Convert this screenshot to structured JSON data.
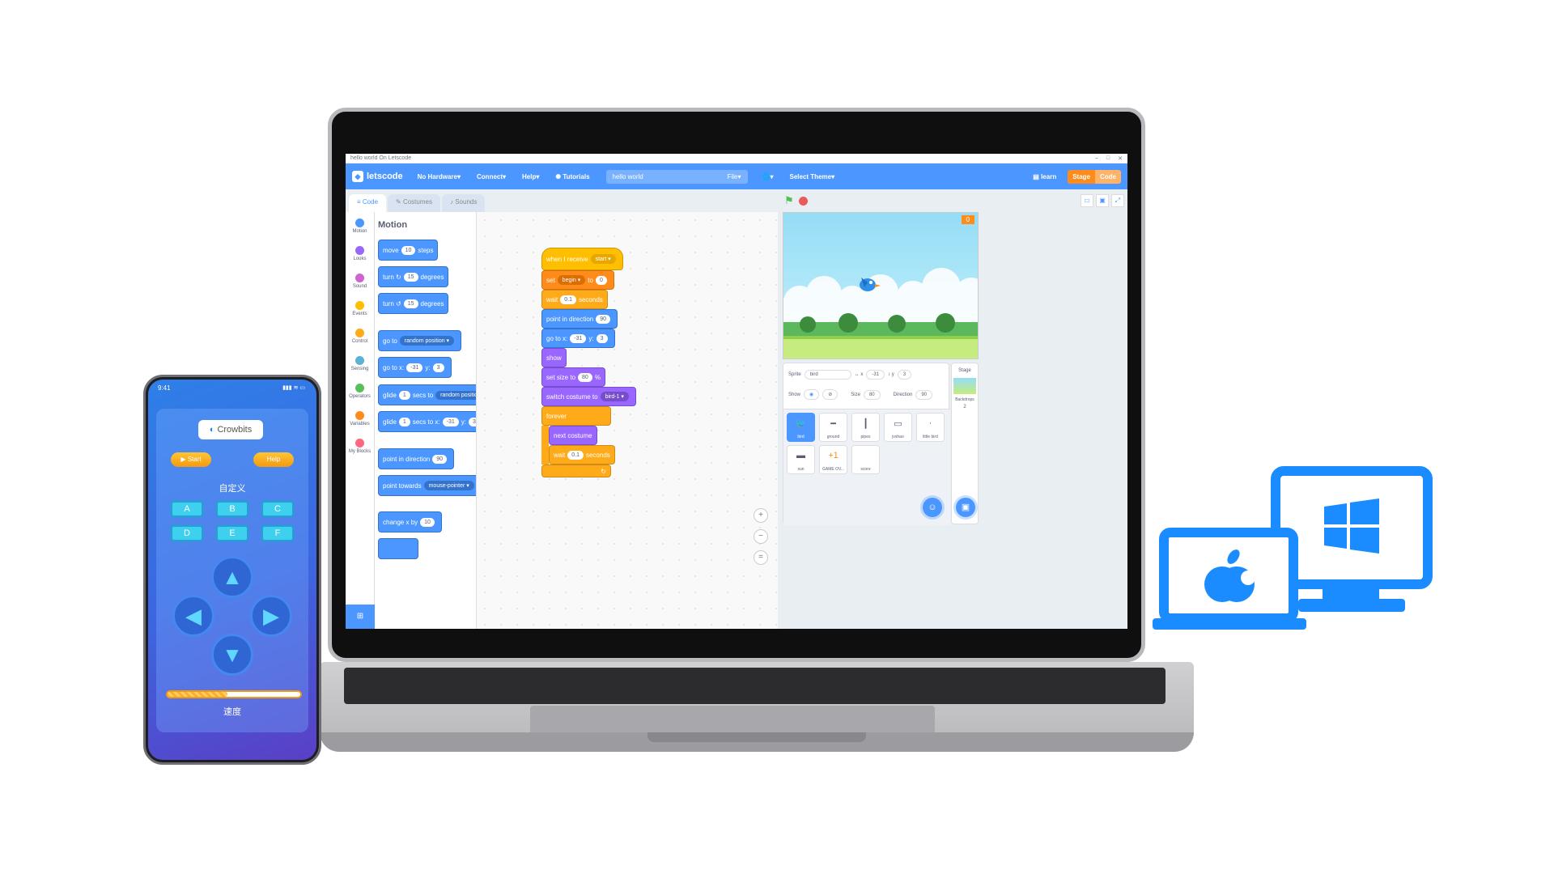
{
  "window": {
    "title": "hello world On Letscode",
    "controls": [
      "–",
      "□",
      "✕"
    ]
  },
  "menubar": {
    "logo": "letscode",
    "hardware": "No Hardware",
    "connect": "Connect",
    "help": "Help",
    "tutorials": "Tutorials",
    "project_name": "hello world",
    "file": "File",
    "theme": "Select Theme",
    "learn": "learn",
    "toggle_stage": "Stage",
    "toggle_code": "Code"
  },
  "tabs": {
    "code": "Code",
    "costumes": "Costumes",
    "sounds": "Sounds"
  },
  "categories": [
    {
      "label": "Motion",
      "color": "#4c97ff"
    },
    {
      "label": "Looks",
      "color": "#9966ff"
    },
    {
      "label": "Sound",
      "color": "#cf63cf"
    },
    {
      "label": "Events",
      "color": "#ffbf00"
    },
    {
      "label": "Control",
      "color": "#ffab19"
    },
    {
      "label": "Sensing",
      "color": "#5cb1d6"
    },
    {
      "label": "Operators",
      "color": "#59c059"
    },
    {
      "label": "Variables",
      "color": "#ff8c1a"
    },
    {
      "label": "My Blocks",
      "color": "#ff6680"
    }
  ],
  "palette": {
    "title": "Motion",
    "blocks": {
      "move": {
        "a": "move",
        "v": "10",
        "b": "steps"
      },
      "turn_r": {
        "a": "turn",
        "v": "15",
        "b": "degrees"
      },
      "turn_l": {
        "a": "turn",
        "v": "15",
        "b": "degrees"
      },
      "goto": {
        "a": "go to",
        "dd": "random position"
      },
      "gotoxy": {
        "a": "go to x:",
        "x": "-31",
        "b": "y:",
        "y": "3"
      },
      "glide1": {
        "a": "glide",
        "v": "1",
        "b": "secs to",
        "dd": "random position"
      },
      "glide2": {
        "a": "glide",
        "v": "1",
        "b": "secs to x:",
        "x": "-31",
        "c": "y:",
        "y": "3"
      },
      "point_dir": {
        "a": "point in direction",
        "v": "90"
      },
      "point_towards": {
        "a": "point towards",
        "dd": "mouse-pointer"
      },
      "change_x": {
        "a": "change x by",
        "v": "10"
      }
    }
  },
  "script": {
    "hat": {
      "a": "when I receive",
      "dd": "start"
    },
    "set": {
      "a": "set",
      "dd": "begin",
      "b": "to",
      "v": "0"
    },
    "wait1": {
      "a": "wait",
      "v": "0.1",
      "b": "seconds"
    },
    "point": {
      "a": "point in direction",
      "v": "90"
    },
    "goto": {
      "a": "go to x:",
      "x": "-31",
      "b": "y:",
      "y": "3"
    },
    "show": "show",
    "size": {
      "a": "set size to",
      "v": "80",
      "b": "%"
    },
    "costume": {
      "a": "switch costume to",
      "dd": "bird-1"
    },
    "forever": "forever",
    "next": "next costume",
    "wait2": {
      "a": "wait",
      "v": "0.1",
      "b": "seconds"
    }
  },
  "stage": {
    "score": "0"
  },
  "sprite_info": {
    "sprite_label": "Sprite",
    "sprite_name": "bird",
    "x_label": "x",
    "x": "-31",
    "y_label": "y",
    "y": "3",
    "show_label": "Show",
    "size_label": "Size",
    "size": "80",
    "direction_label": "Direction",
    "direction": "90"
  },
  "sprites": [
    "bird",
    "ground",
    "pipes",
    "jvshao",
    "little bird",
    "sun",
    "GAME OV...",
    "score"
  ],
  "stage_pane": {
    "label": "Stage",
    "backdrops_label": "Backdrops",
    "backdrops": "2"
  },
  "phone": {
    "time": "9:41",
    "logo": "Crowbits",
    "start": "Start",
    "help": "Help",
    "title": "自定义",
    "keys": [
      "A",
      "B",
      "C",
      "D",
      "E",
      "F"
    ],
    "speed_label": "速度",
    "speed_level": 0.45
  },
  "icons": {
    "flag": "green-flag-icon",
    "stop": "stop-icon",
    "apple": "apple-laptop-icon",
    "windows": "windows-monitor-icon"
  },
  "colors": {
    "brand": "#4c97ff",
    "accent": "#ff8c1a",
    "os_icons": "#1a8cff"
  }
}
